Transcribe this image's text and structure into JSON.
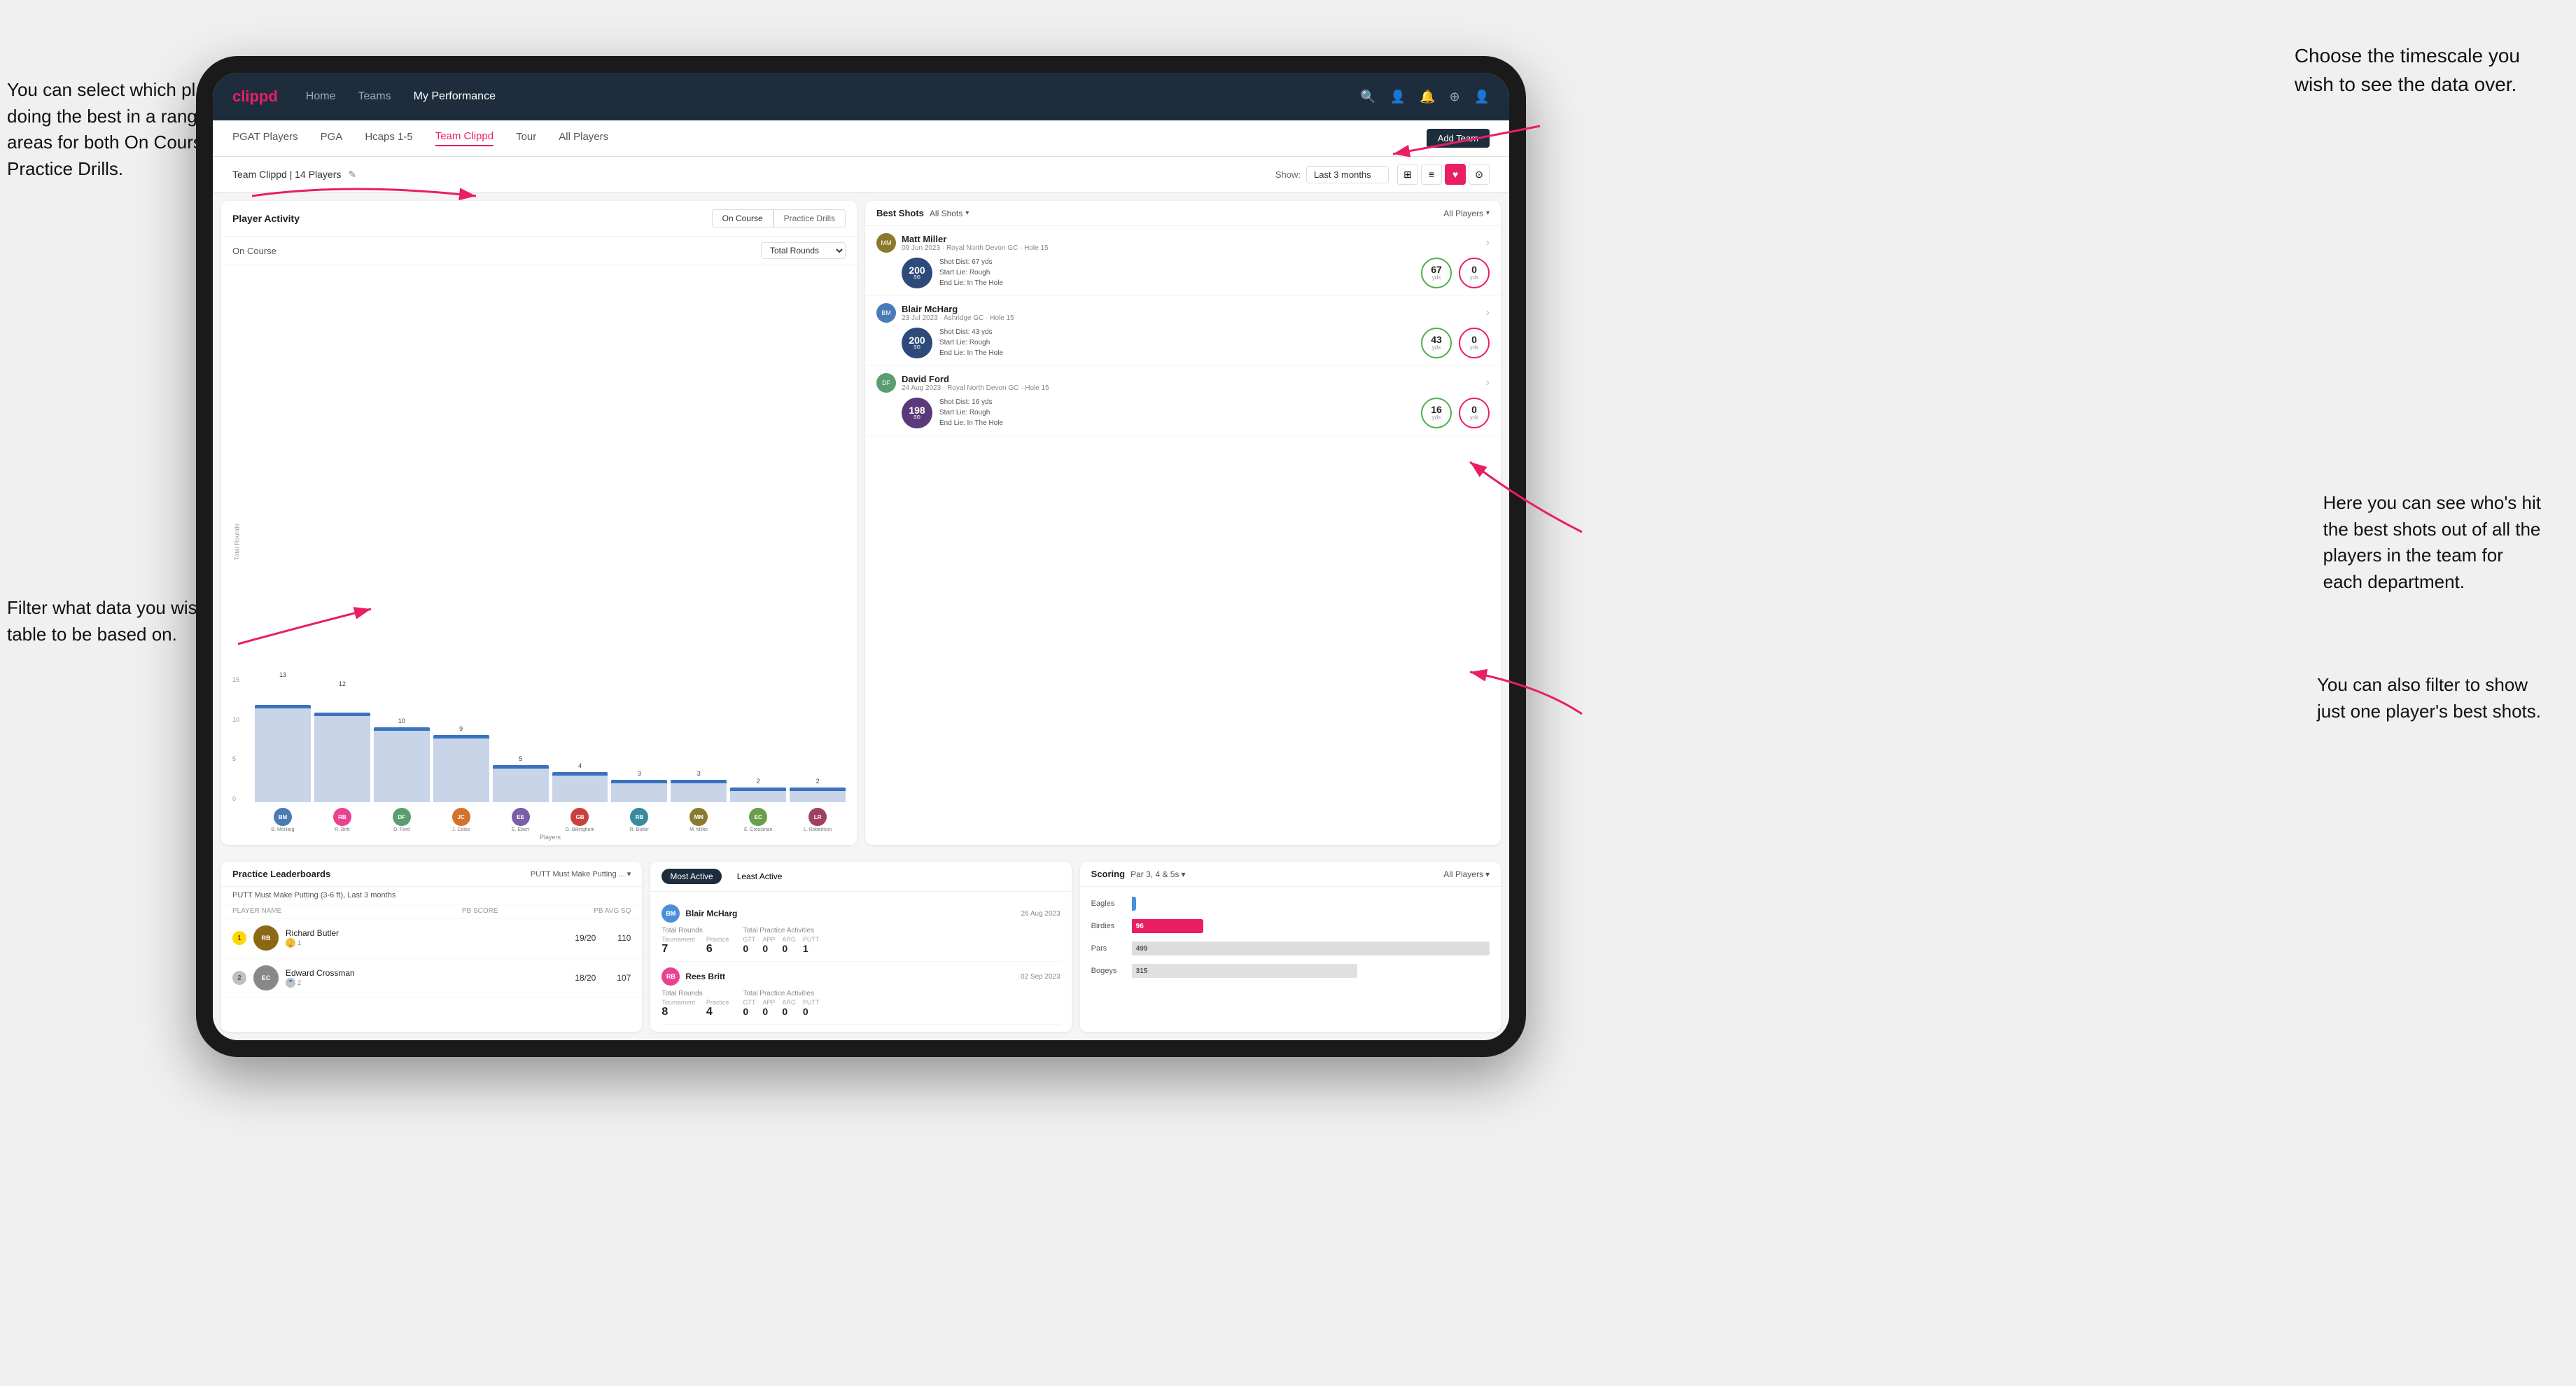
{
  "annotations": {
    "top_right": "Choose the timescale you\nwish to see the data over.",
    "top_left": "You can select which player is\ndoing the best in a range of\nareas for both On Course and\nPractice Drills.",
    "bottom_left": "Filter what data you wish the\ntable to be based on.",
    "bottom_right": "Here you can see who's hit\nthe best shots out of all the\nplayers in the team for\neach department.",
    "bottom_right2": "You can also filter to show\njust one player's best shots."
  },
  "nav": {
    "logo": "clippd",
    "items": [
      "Home",
      "Teams",
      "My Performance"
    ],
    "active": "My Performance"
  },
  "sub_nav": {
    "items": [
      "PGAT Players",
      "PGA",
      "Hcaps 1-5",
      "Team Clippd",
      "Tour",
      "All Players"
    ],
    "active": "Team Clippd",
    "add_team_button": "Add Team"
  },
  "team_header": {
    "name": "Team Clippd | 14 Players",
    "show_label": "Show:",
    "show_value": "Last 3 months",
    "view_options": [
      "grid",
      "list",
      "heart",
      "settings"
    ]
  },
  "player_activity": {
    "title": "Player Activity",
    "tabs": [
      "On Course",
      "Practice Drills"
    ],
    "active_tab": "On Course",
    "subtitle": "On Course",
    "dropdown": "Total Rounds",
    "y_label": "Total Rounds",
    "x_label": "Players",
    "bars": [
      {
        "name": "B. McHarg",
        "value": 13,
        "max": 15
      },
      {
        "name": "R. Britt",
        "value": 12,
        "max": 15
      },
      {
        "name": "D. Ford",
        "value": 10,
        "max": 15
      },
      {
        "name": "J. Coles",
        "value": 9,
        "max": 15
      },
      {
        "name": "E. Ebert",
        "value": 5,
        "max": 15
      },
      {
        "name": "G. Billingham",
        "value": 4,
        "max": 15
      },
      {
        "name": "R. Butler",
        "value": 3,
        "max": 15
      },
      {
        "name": "M. Miller",
        "value": 3,
        "max": 15
      },
      {
        "name": "E. Crossman",
        "value": 2,
        "max": 15
      },
      {
        "name": "L. Robertson",
        "value": 2,
        "max": 15
      }
    ],
    "y_ticks": [
      "0",
      "5",
      "10",
      "15"
    ]
  },
  "best_shots": {
    "title": "Best Shots",
    "filter1": "All Shots",
    "filter2": "All Players",
    "players": [
      {
        "name": "Matt Miller",
        "date": "09 Jun 2023",
        "course": "Royal North Devon GC",
        "hole": "Hole 15",
        "badge_num": "200",
        "badge_label": "SG",
        "shot_dist": "67 yds",
        "start_lie": "Rough",
        "end_lie": "In The Hole",
        "stat1_val": "67",
        "stat1_unit": "yds",
        "stat1_color": "green",
        "stat2_val": "0",
        "stat2_unit": "yds",
        "stat2_color": "pink"
      },
      {
        "name": "Blair McHarg",
        "date": "23 Jul 2023",
        "course": "Ashridge GC",
        "hole": "Hole 15",
        "badge_num": "200",
        "badge_label": "SG",
        "shot_dist": "43 yds",
        "start_lie": "Rough",
        "end_lie": "In The Hole",
        "stat1_val": "43",
        "stat1_unit": "yds",
        "stat1_color": "green",
        "stat2_val": "0",
        "stat2_unit": "yds",
        "stat2_color": "pink"
      },
      {
        "name": "David Ford",
        "date": "24 Aug 2023",
        "course": "Royal North Devon GC",
        "hole": "Hole 15",
        "badge_num": "198",
        "badge_label": "SG",
        "shot_dist": "16 yds",
        "start_lie": "Rough",
        "end_lie": "In The Hole",
        "stat1_val": "16",
        "stat1_unit": "yds",
        "stat1_color": "green",
        "stat2_val": "0",
        "stat2_unit": "yds",
        "stat2_color": "pink"
      }
    ]
  },
  "leaderboard": {
    "title": "Practice Leaderboards",
    "dropdown": "PUTT Must Make Putting ...",
    "drill_name": "PUTT Must Make Putting (3-6 ft), Last 3 months",
    "cols": [
      "PLAYER NAME",
      "PB SCORE",
      "PB AVG SQ"
    ],
    "rows": [
      {
        "rank": 1,
        "rank_style": "gold",
        "name": "Richard Butler",
        "avatar_color": "#8B6914",
        "score": "19/20",
        "avg": "110"
      },
      {
        "rank": 2,
        "rank_style": "silver",
        "name": "Edward Crossman",
        "avatar_color": "#888",
        "score": "18/20",
        "avg": "107"
      }
    ]
  },
  "activity_stats": {
    "tabs": [
      "Most Active",
      "Least Active"
    ],
    "active_tab": "Most Active",
    "players": [
      {
        "name": "Blair McHarg",
        "avatar_color": "#4a90d9",
        "date": "26 Aug 2023",
        "total_rounds_label": "Total Rounds",
        "practice_activities_label": "Total Practice Activities",
        "tournament": "7",
        "practice": "6",
        "gtt": "0",
        "app": "0",
        "arg": "0",
        "putt": "1"
      },
      {
        "name": "Rees Britt",
        "avatar_color": "#e84393",
        "date": "02 Sep 2023",
        "tournament": "8",
        "practice": "4",
        "gtt": "0",
        "app": "0",
        "arg": "0",
        "putt": "0"
      }
    ]
  },
  "scoring": {
    "title": "Scoring",
    "dropdown1": "Par 3, 4 & 5s",
    "dropdown2": "All Players",
    "rows": [
      {
        "label": "Eagles",
        "value": 3,
        "max": 500,
        "color": "#4a90d9",
        "bar_value": "3"
      },
      {
        "label": "Birdies",
        "value": 96,
        "max": 500,
        "color": "#e91e63",
        "bar_value": "96"
      },
      {
        "label": "Pars",
        "value": 499,
        "max": 500,
        "color": "#ddd",
        "bar_value": "499"
      },
      {
        "label": "Bogeys",
        "value": 315,
        "max": 500,
        "color": "#ddd",
        "bar_value": "315"
      }
    ]
  },
  "avatar_colors": [
    "#4a7bb5",
    "#e84393",
    "#5a9e6f",
    "#d4722a",
    "#7b5ea7",
    "#c94040",
    "#3a8a9e",
    "#8a7a2e",
    "#6b9e4a",
    "#a04060"
  ]
}
